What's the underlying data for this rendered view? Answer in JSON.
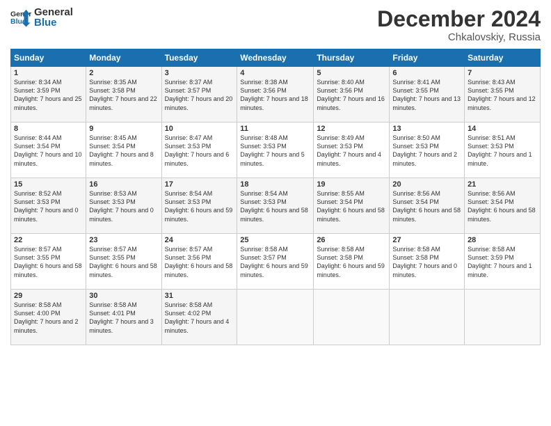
{
  "header": {
    "title": "December 2024",
    "location": "Chkalovskiy, Russia"
  },
  "weekdays": [
    "Sunday",
    "Monday",
    "Tuesday",
    "Wednesday",
    "Thursday",
    "Friday",
    "Saturday"
  ],
  "days": [
    {
      "num": "1",
      "rise": "8:34 AM",
      "set": "3:59 PM",
      "daylight": "7 hours and 25 minutes."
    },
    {
      "num": "2",
      "rise": "8:35 AM",
      "set": "3:58 PM",
      "daylight": "7 hours and 22 minutes."
    },
    {
      "num": "3",
      "rise": "8:37 AM",
      "set": "3:57 PM",
      "daylight": "7 hours and 20 minutes."
    },
    {
      "num": "4",
      "rise": "8:38 AM",
      "set": "3:56 PM",
      "daylight": "7 hours and 18 minutes."
    },
    {
      "num": "5",
      "rise": "8:40 AM",
      "set": "3:56 PM",
      "daylight": "7 hours and 16 minutes."
    },
    {
      "num": "6",
      "rise": "8:41 AM",
      "set": "3:55 PM",
      "daylight": "7 hours and 13 minutes."
    },
    {
      "num": "7",
      "rise": "8:43 AM",
      "set": "3:55 PM",
      "daylight": "7 hours and 12 minutes."
    },
    {
      "num": "8",
      "rise": "8:44 AM",
      "set": "3:54 PM",
      "daylight": "7 hours and 10 minutes."
    },
    {
      "num": "9",
      "rise": "8:45 AM",
      "set": "3:54 PM",
      "daylight": "7 hours and 8 minutes."
    },
    {
      "num": "10",
      "rise": "8:47 AM",
      "set": "3:53 PM",
      "daylight": "7 hours and 6 minutes."
    },
    {
      "num": "11",
      "rise": "8:48 AM",
      "set": "3:53 PM",
      "daylight": "7 hours and 5 minutes."
    },
    {
      "num": "12",
      "rise": "8:49 AM",
      "set": "3:53 PM",
      "daylight": "7 hours and 4 minutes."
    },
    {
      "num": "13",
      "rise": "8:50 AM",
      "set": "3:53 PM",
      "daylight": "7 hours and 2 minutes."
    },
    {
      "num": "14",
      "rise": "8:51 AM",
      "set": "3:53 PM",
      "daylight": "7 hours and 1 minute."
    },
    {
      "num": "15",
      "rise": "8:52 AM",
      "set": "3:53 PM",
      "daylight": "7 hours and 0 minutes."
    },
    {
      "num": "16",
      "rise": "8:53 AM",
      "set": "3:53 PM",
      "daylight": "7 hours and 0 minutes."
    },
    {
      "num": "17",
      "rise": "8:54 AM",
      "set": "3:53 PM",
      "daylight": "6 hours and 59 minutes."
    },
    {
      "num": "18",
      "rise": "8:54 AM",
      "set": "3:53 PM",
      "daylight": "6 hours and 58 minutes."
    },
    {
      "num": "19",
      "rise": "8:55 AM",
      "set": "3:54 PM",
      "daylight": "6 hours and 58 minutes."
    },
    {
      "num": "20",
      "rise": "8:56 AM",
      "set": "3:54 PM",
      "daylight": "6 hours and 58 minutes."
    },
    {
      "num": "21",
      "rise": "8:56 AM",
      "set": "3:54 PM",
      "daylight": "6 hours and 58 minutes."
    },
    {
      "num": "22",
      "rise": "8:57 AM",
      "set": "3:55 PM",
      "daylight": "6 hours and 58 minutes."
    },
    {
      "num": "23",
      "rise": "8:57 AM",
      "set": "3:55 PM",
      "daylight": "6 hours and 58 minutes."
    },
    {
      "num": "24",
      "rise": "8:57 AM",
      "set": "3:56 PM",
      "daylight": "6 hours and 58 minutes."
    },
    {
      "num": "25",
      "rise": "8:58 AM",
      "set": "3:57 PM",
      "daylight": "6 hours and 59 minutes."
    },
    {
      "num": "26",
      "rise": "8:58 AM",
      "set": "3:58 PM",
      "daylight": "6 hours and 59 minutes."
    },
    {
      "num": "27",
      "rise": "8:58 AM",
      "set": "3:58 PM",
      "daylight": "7 hours and 0 minutes."
    },
    {
      "num": "28",
      "rise": "8:58 AM",
      "set": "3:59 PM",
      "daylight": "7 hours and 1 minute."
    },
    {
      "num": "29",
      "rise": "8:58 AM",
      "set": "4:00 PM",
      "daylight": "7 hours and 2 minutes."
    },
    {
      "num": "30",
      "rise": "8:58 AM",
      "set": "4:01 PM",
      "daylight": "7 hours and 3 minutes."
    },
    {
      "num": "31",
      "rise": "8:58 AM",
      "set": "4:02 PM",
      "daylight": "7 hours and 4 minutes."
    }
  ],
  "startDay": 0
}
